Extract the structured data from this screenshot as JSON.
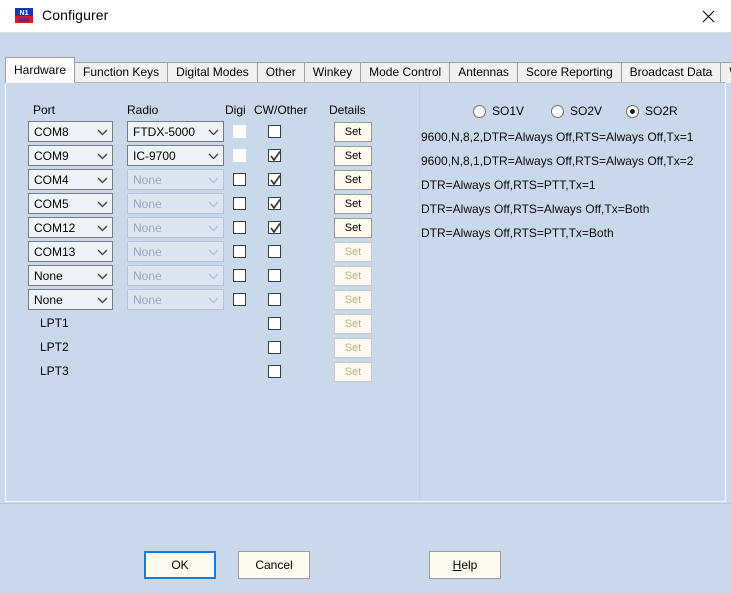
{
  "window": {
    "title": "Configurer",
    "icon": "n1mm-logo-icon",
    "close_label": "✕"
  },
  "tabs": [
    {
      "label": "Hardware",
      "active": true
    },
    {
      "label": "Function Keys",
      "active": false
    },
    {
      "label": "Digital Modes",
      "active": false
    },
    {
      "label": "Other",
      "active": false
    },
    {
      "label": "Winkey",
      "active": false
    },
    {
      "label": "Mode Control",
      "active": false
    },
    {
      "label": "Antennas",
      "active": false
    },
    {
      "label": "Score Reporting",
      "active": false
    },
    {
      "label": "Broadcast Data",
      "active": false
    },
    {
      "label": "WSJT/JTDX Setup",
      "active": false
    }
  ],
  "hardware": {
    "headers": {
      "port": "Port",
      "radio": "Radio",
      "digi": "Digi",
      "cw_other": "CW/Other",
      "details": "Details"
    },
    "set_label": "Set",
    "rows": [
      {
        "port": "COM8",
        "port_type": "combo",
        "radio": "FTDX-5000",
        "radio_enabled": true,
        "digi": "hidden-unchecked",
        "cw": false,
        "set_enabled": true
      },
      {
        "port": "COM9",
        "port_type": "combo",
        "radio": "IC-9700",
        "radio_enabled": true,
        "digi": "hidden-unchecked",
        "cw": true,
        "set_enabled": true
      },
      {
        "port": "COM4",
        "port_type": "combo",
        "radio": "None",
        "radio_enabled": false,
        "digi": "unchecked",
        "cw": true,
        "set_enabled": true
      },
      {
        "port": "COM5",
        "port_type": "combo",
        "radio": "None",
        "radio_enabled": false,
        "digi": "unchecked",
        "cw": true,
        "set_enabled": true
      },
      {
        "port": "COM12",
        "port_type": "combo",
        "radio": "None",
        "radio_enabled": false,
        "digi": "unchecked",
        "cw": true,
        "set_enabled": true
      },
      {
        "port": "COM13",
        "port_type": "combo",
        "radio": "None",
        "radio_enabled": false,
        "digi": "unchecked",
        "cw": false,
        "set_enabled": false
      },
      {
        "port": "None",
        "port_type": "combo",
        "radio": "None",
        "radio_enabled": false,
        "digi": "unchecked",
        "cw": false,
        "set_enabled": false
      },
      {
        "port": "None",
        "port_type": "combo",
        "radio": "None",
        "radio_enabled": false,
        "digi": "unchecked",
        "cw": false,
        "set_enabled": false
      },
      {
        "port": "LPT1",
        "port_type": "label",
        "radio": "",
        "radio_enabled": false,
        "digi": "none",
        "cw": false,
        "set_enabled": false
      },
      {
        "port": "LPT2",
        "port_type": "label",
        "radio": "",
        "radio_enabled": false,
        "digi": "none",
        "cw": false,
        "set_enabled": false
      },
      {
        "port": "LPT3",
        "port_type": "label",
        "radio": "",
        "radio_enabled": false,
        "digi": "none",
        "cw": false,
        "set_enabled": false
      }
    ]
  },
  "operating_mode": {
    "options": [
      {
        "label": "SO1V",
        "selected": false
      },
      {
        "label": "SO2V",
        "selected": false
      },
      {
        "label": "SO2R",
        "selected": true
      }
    ]
  },
  "details_lines": [
    "9600,N,8,2,DTR=Always Off,RTS=Always Off,Tx=1",
    "9600,N,8,1,DTR=Always Off,RTS=Always Off,Tx=2",
    "DTR=Always Off,RTS=PTT,Tx=1",
    "DTR=Always Off,RTS=Always Off,Tx=Both",
    "DTR=Always Off,RTS=PTT,Tx=Both"
  ],
  "footer": {
    "ok_label": "OK",
    "cancel_label": "Cancel",
    "help_label": "Help",
    "help_accel": "H"
  },
  "colors": {
    "window_bg": "#c9d8ea",
    "titlebar_bg": "#ffffff",
    "button_face": "#fdfbf0",
    "focus_border": "#1a7ad1",
    "disabled_text": "#c4ae7a"
  }
}
